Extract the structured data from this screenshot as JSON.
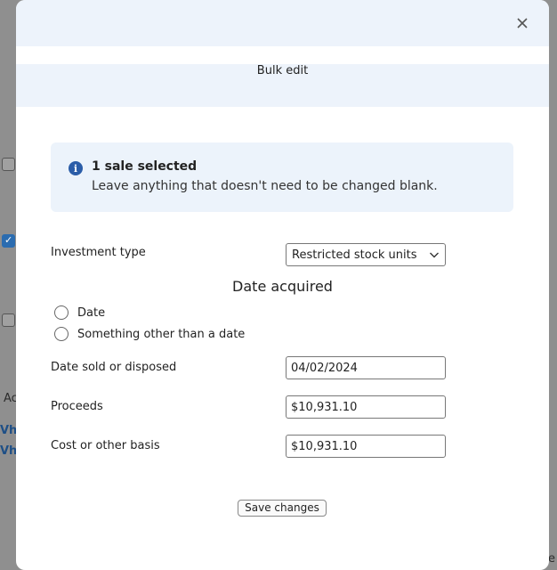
{
  "background": {
    "fragments": [
      "Ac",
      "Vhy",
      "Vha",
      "e"
    ]
  },
  "modal": {
    "close_icon": "close-icon",
    "title": "Bulk edit",
    "info": {
      "icon": "info-icon",
      "icon_glyph": "i",
      "title": "1 sale selected",
      "body": "Leave anything that doesn't need to be changed blank."
    },
    "investment_type": {
      "label": "Investment type",
      "selected": "Restricted stock units"
    },
    "date_acquired": {
      "heading": "Date acquired",
      "options": [
        "Date",
        "Something other than a date"
      ]
    },
    "date_sold": {
      "label": "Date sold or disposed",
      "value": "04/02/2024"
    },
    "proceeds": {
      "label": "Proceeds",
      "value": "$10,931.10"
    },
    "cost_basis": {
      "label": "Cost or other basis",
      "value": "$10,931.10"
    },
    "save_label": "Save changes"
  },
  "colors": {
    "accent": "#2b5da8",
    "band": "#edf3fb",
    "info_bg": "#ecf3fb"
  }
}
